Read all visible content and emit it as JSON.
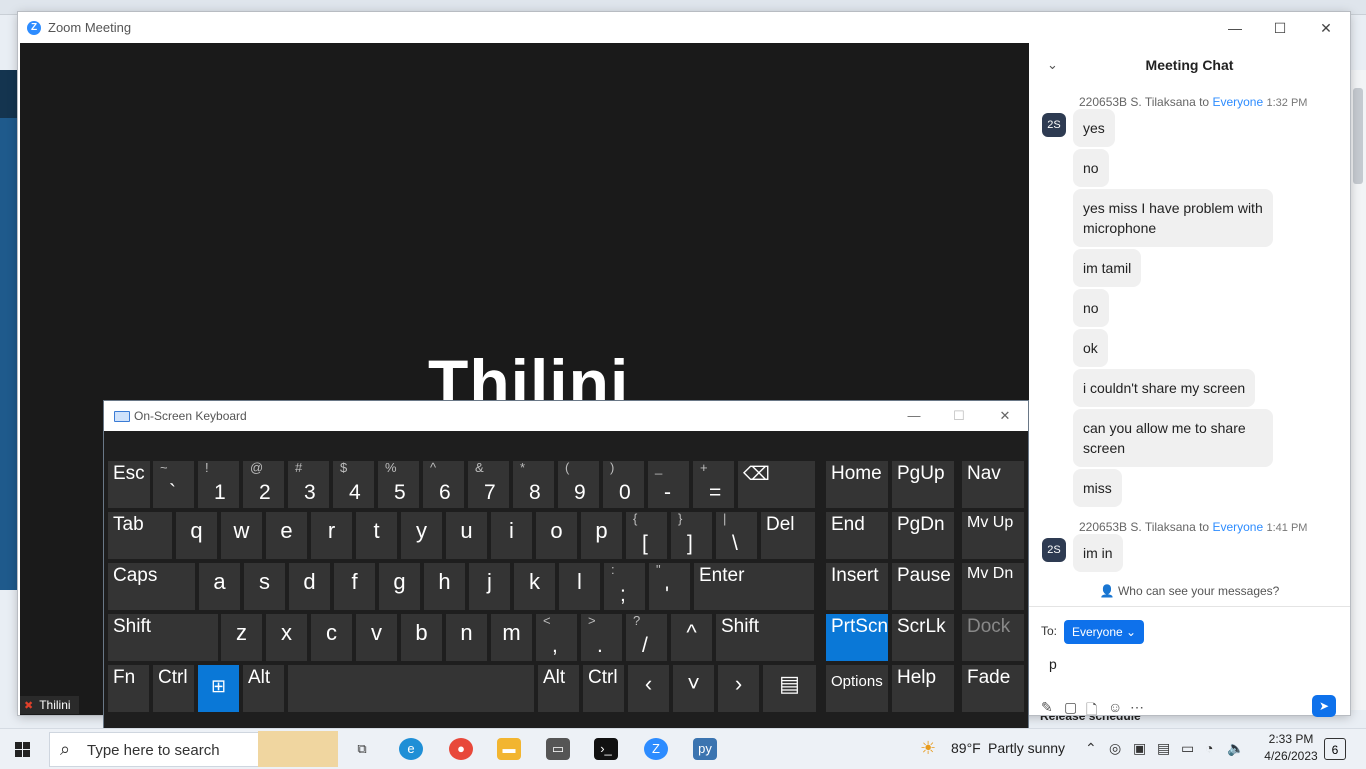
{
  "zoom": {
    "window_title": "Zoom Meeting",
    "logo_letter": "Z",
    "participant_name": "Thilini",
    "name_tag": "Thilini",
    "controls": {
      "minimize": "—",
      "maximize": "☐",
      "close": "✕"
    }
  },
  "chat": {
    "collapse_glyph": "⌄",
    "title": "Meeting Chat",
    "groups": [
      {
        "sender": "220653B S. Tilaksana",
        "to_word": "to",
        "recipient": "Everyone",
        "time": "1:32 PM",
        "avatar": "2S",
        "messages": [
          "yes",
          "no",
          "yes miss  I have problem with microphone",
          "im tamil",
          "no",
          "ok",
          "i couldn't share my screen",
          "can you allow me to share screen",
          "miss"
        ]
      },
      {
        "sender": "220653B S. Tilaksana",
        "to_word": "to",
        "recipient": "Everyone",
        "time": "1:41 PM",
        "avatar": "2S",
        "messages": [
          "im in"
        ]
      }
    ],
    "privacy_note": "Who can see your messages?",
    "to_label": "To:",
    "to_value": "Everyone",
    "input_value": "p"
  },
  "osk": {
    "title": "On-Screen Keyboard",
    "controls": {
      "minimize": "—",
      "maximize": "☐",
      "close": "✕"
    },
    "rows": [
      [
        {
          "label": "Esc",
          "name": "esc"
        },
        {
          "top": "~",
          "bot": "`",
          "name": "backtick"
        },
        {
          "top": "!",
          "bot": "1",
          "name": "1"
        },
        {
          "top": "@",
          "bot": "2",
          "name": "2"
        },
        {
          "top": "#",
          "bot": "3",
          "name": "3"
        },
        {
          "top": "$",
          "bot": "4",
          "name": "4"
        },
        {
          "top": "%",
          "bot": "5",
          "name": "5"
        },
        {
          "top": "^",
          "bot": "6",
          "name": "6"
        },
        {
          "top": "&",
          "bot": "7",
          "name": "7"
        },
        {
          "top": "*",
          "bot": "8",
          "name": "8"
        },
        {
          "top": "(",
          "bot": "9",
          "name": "9"
        },
        {
          "top": ")",
          "bot": "0",
          "name": "0"
        },
        {
          "top": "_",
          "bot": "-",
          "name": "minus"
        },
        {
          "top": "+",
          "bot": "=",
          "name": "equals"
        },
        {
          "label": "⌫",
          "name": "backspace"
        },
        {
          "label": "Home",
          "name": "home"
        },
        {
          "label": "PgUp",
          "name": "pgup"
        },
        {
          "label": "Nav",
          "name": "nav"
        }
      ],
      [
        {
          "label": "Tab",
          "name": "tab"
        },
        {
          "big": "q",
          "name": "q"
        },
        {
          "big": "w",
          "name": "w"
        },
        {
          "big": "e",
          "name": "e"
        },
        {
          "big": "r",
          "name": "r"
        },
        {
          "big": "t",
          "name": "t"
        },
        {
          "big": "y",
          "name": "y"
        },
        {
          "big": "u",
          "name": "u"
        },
        {
          "big": "i",
          "name": "i"
        },
        {
          "big": "o",
          "name": "o"
        },
        {
          "big": "p",
          "name": "p"
        },
        {
          "top": "{",
          "bot": "[",
          "name": "lbracket"
        },
        {
          "top": "}",
          "bot": "]",
          "name": "rbracket"
        },
        {
          "top": "|",
          "bot": "\\",
          "name": "backslash"
        },
        {
          "label": "Del",
          "name": "del"
        },
        {
          "label": "End",
          "name": "end"
        },
        {
          "label": "PgDn",
          "name": "pgdn"
        },
        {
          "label": "Mv Up",
          "name": "mvup"
        }
      ],
      [
        {
          "label": "Caps",
          "name": "caps"
        },
        {
          "big": "a",
          "name": "a"
        },
        {
          "big": "s",
          "name": "s"
        },
        {
          "big": "d",
          "name": "d"
        },
        {
          "big": "f",
          "name": "f"
        },
        {
          "big": "g",
          "name": "g"
        },
        {
          "big": "h",
          "name": "h"
        },
        {
          "big": "j",
          "name": "j"
        },
        {
          "big": "k",
          "name": "k"
        },
        {
          "big": "l",
          "name": "l"
        },
        {
          "top": ":",
          "bot": ";",
          "name": "semicolon"
        },
        {
          "top": "\"",
          "bot": "'",
          "name": "quote"
        },
        {
          "label": "Enter",
          "name": "enter"
        },
        {
          "label": "Insert",
          "name": "insert"
        },
        {
          "label": "Pause",
          "name": "pause"
        },
        {
          "label": "Mv Dn",
          "name": "mvdn"
        }
      ],
      [
        {
          "label": "Shift",
          "name": "lshift"
        },
        {
          "big": "z",
          "name": "z"
        },
        {
          "big": "x",
          "name": "x"
        },
        {
          "big": "c",
          "name": "c"
        },
        {
          "big": "v",
          "name": "v"
        },
        {
          "big": "b",
          "name": "b"
        },
        {
          "big": "n",
          "name": "n"
        },
        {
          "big": "m",
          "name": "m"
        },
        {
          "top": "<",
          "bot": ",",
          "name": "comma"
        },
        {
          "top": ">",
          "bot": ".",
          "name": "period"
        },
        {
          "top": "?",
          "bot": "/",
          "name": "slash"
        },
        {
          "big": "^",
          "name": "up"
        },
        {
          "label": "Shift",
          "name": "rshift"
        },
        {
          "label": "PrtScn",
          "name": "prtscn",
          "active": true
        },
        {
          "label": "ScrLk",
          "name": "scrlk"
        },
        {
          "label": "Dock",
          "name": "dock",
          "dim": true
        }
      ],
      [
        {
          "label": "Fn",
          "name": "fn"
        },
        {
          "label": "Ctrl",
          "name": "lctrl"
        },
        {
          "big": "⊞",
          "name": "win",
          "active": true
        },
        {
          "label": "Alt",
          "name": "lalt"
        },
        {
          "label": "",
          "name": "space"
        },
        {
          "label": "Alt",
          "name": "ralt"
        },
        {
          "label": "Ctrl",
          "name": "rctrl"
        },
        {
          "big": "‹",
          "name": "left"
        },
        {
          "big": "˅",
          "name": "down"
        },
        {
          "big": "›",
          "name": "right"
        },
        {
          "big": "▤",
          "name": "menu"
        },
        {
          "label": "Options",
          "name": "options",
          "small": true
        },
        {
          "label": "Help",
          "name": "help"
        },
        {
          "label": "Fade",
          "name": "fade"
        }
      ]
    ]
  },
  "taskbar": {
    "search_placeholder": "Type here to search",
    "weather_temp": "89°F",
    "weather_desc": "Partly sunny",
    "time": "2:33 PM",
    "date": "4/26/2023",
    "notification_count": "6"
  },
  "background": {
    "release_schedule": "Release schedule"
  }
}
